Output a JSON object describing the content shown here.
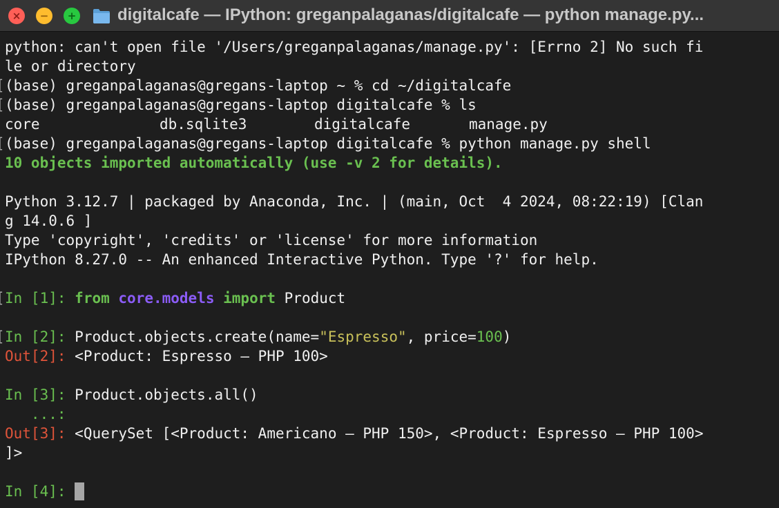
{
  "window": {
    "title": "digitalcafe — IPython: greganpalaganas/digitalcafe — python manage.py...",
    "close_glyph": "×",
    "minimize_glyph": "−",
    "zoom_glyph": "+",
    "folder_icon": "folder-icon",
    "colors": {
      "background": "#1e1e1e",
      "titlebar": "#353535",
      "prompt_green": "#6ac050",
      "out_red": "#e0543a",
      "keyword_green": "#6ac050",
      "module_purple": "#8b5cf6",
      "string_yellow": "#c9c15a",
      "cursor": "#a6a6a6"
    }
  },
  "terminal": {
    "err_line_1": "python: can't open file '/Users/greganpalaganas/manage.py': [Errno 2] No such fi",
    "err_line_2": "le or directory",
    "cmd_cd": "(base) greganpalaganas@gregans-laptop ~ % cd ~/digitalcafe",
    "cmd_ls": "(base) greganpalaganas@gregans-laptop digitalcafe % ls",
    "ls_output": [
      "core",
      "db.sqlite3",
      "digitalcafe",
      "manage.py"
    ],
    "cmd_shell": "(base) greganpalaganas@gregans-laptop digitalcafe % python manage.py shell",
    "imported_msg": "10 objects imported automatically (use -v 2 for details).",
    "py_line_1": "Python 3.12.7 | packaged by Anaconda, Inc. | (main, Oct  4 2024, 08:22:19) [Clan",
    "py_line_2": "g 14.0.6 ]",
    "type_line": "Type 'copyright', 'credits' or 'license' for more information",
    "ipython_line": "IPython 8.27.0 -- An enhanced Interactive Python. Type '?' for help.",
    "in1": {
      "prompt": "In [1]:",
      "kw_from": "from",
      "module": "core.models",
      "kw_import": "import",
      "name": "Product"
    },
    "in2": {
      "prompt": "In [2]:",
      "code_a": "Product.objects.create(name=",
      "string": "\"Espresso\"",
      "code_b": ", price=",
      "number": "100",
      "code_c": ")"
    },
    "out2": {
      "prompt": "Out[2]:",
      "text": "<Product: Espresso — PHP 100>"
    },
    "in3": {
      "prompt": "In [3]:",
      "code": "Product.objects.all()",
      "continuation": "   ...:"
    },
    "out3": {
      "prompt": "Out[3]:",
      "text": "<QuerySet [<Product: Americano — PHP 150>, <Product: Espresso — PHP 100>",
      "text_2": "]>"
    },
    "in4": {
      "prompt": "In [4]:"
    }
  }
}
